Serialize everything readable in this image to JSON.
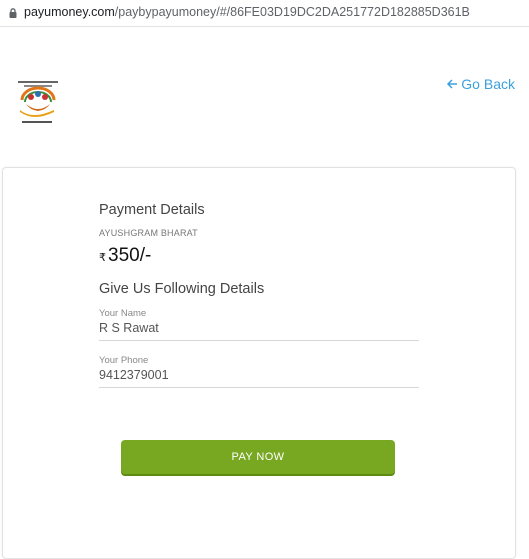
{
  "browser": {
    "url_host": "payumoney.com",
    "url_path": "/paybypayumoney/#/86FE03D19DC2DA251772D182885D361B"
  },
  "header": {
    "go_back_label": "Go Back"
  },
  "payment": {
    "section_title": "Payment Details",
    "merchant": "AYUSHGRAM BHARAT",
    "currency_symbol": "₹",
    "amount": "350/-"
  },
  "form": {
    "section_title": "Give Us Following Details",
    "name_label": "Your Name",
    "name_value": "R S Rawat",
    "phone_label": "Your Phone",
    "phone_value": "9412379001",
    "submit_label": "PAY NOW"
  },
  "colors": {
    "accent": "#3ba0dd",
    "button": "#78a722"
  }
}
